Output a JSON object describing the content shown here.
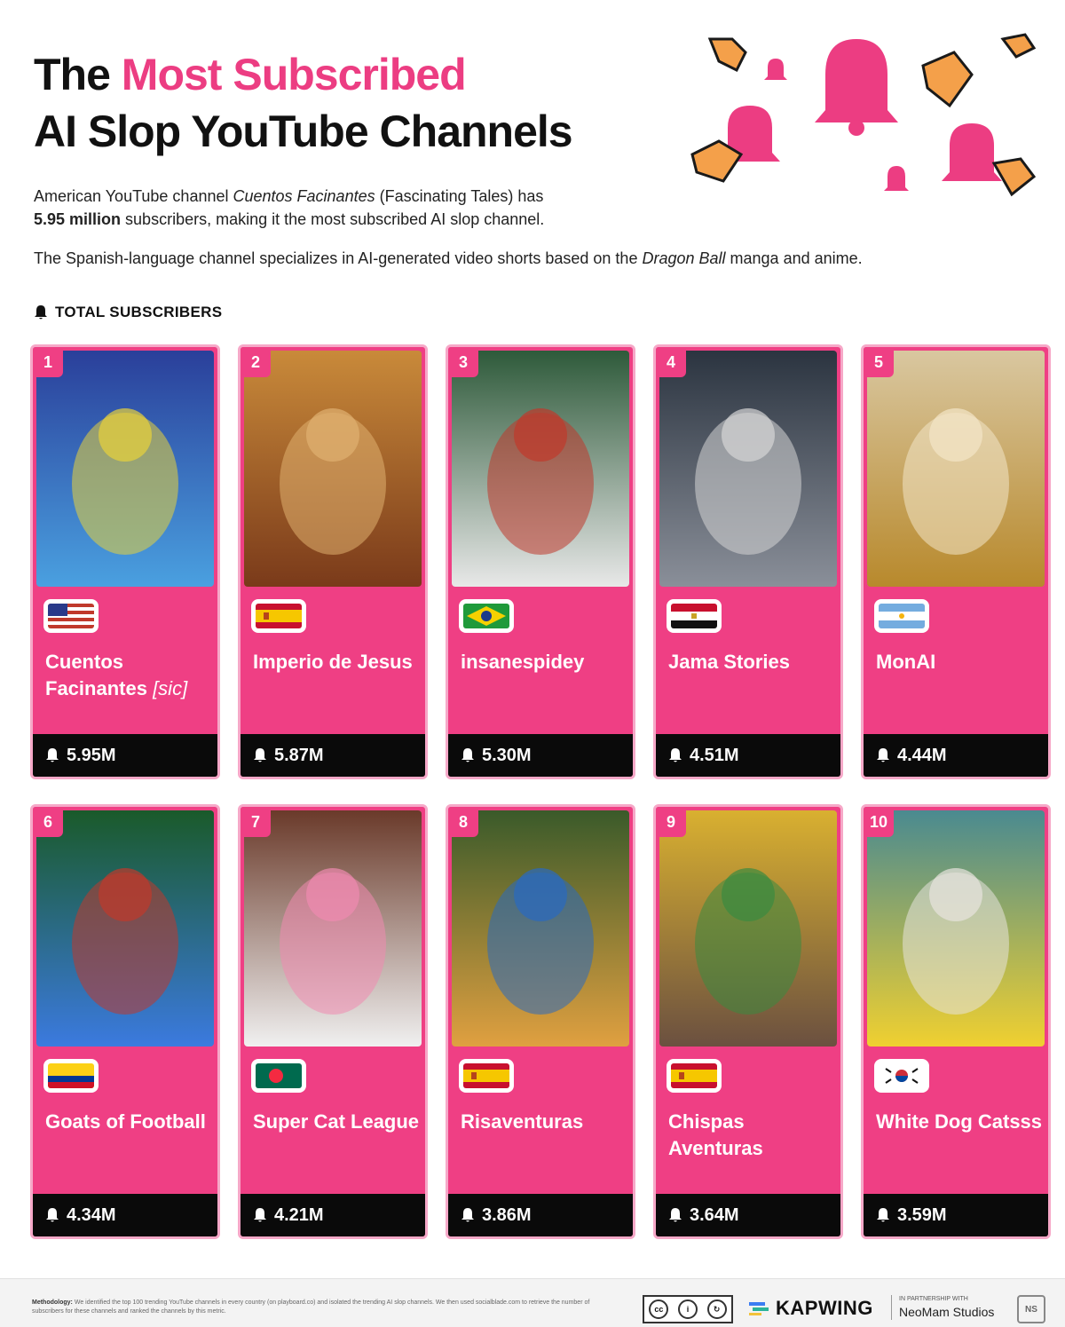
{
  "header": {
    "title_prefix": "The ",
    "title_accent": "Most Subscribed",
    "title_line2": "AI Slop YouTube Channels"
  },
  "intro": {
    "p1_a": "American YouTube channel ",
    "p1_channel": "Cuentos Facinantes",
    "p1_b": " (Fascinating Tales) has ",
    "p1_bold": "5.95 million",
    "p1_c": " subscribers, making it the most subscribed AI slop channel.",
    "p2_a": "The Spanish-language channel specializes in AI-generated video shorts based on the ",
    "p2_italic": "Dragon Ball",
    "p2_b": " manga and anime."
  },
  "legend": {
    "label": "TOTAL SUBSCRIBERS",
    "icon": "bell-icon"
  },
  "colors": {
    "accent": "#ec3d82",
    "card": "#ef3f84",
    "card_border": "#f6a8c8",
    "stat_bar": "#0a0a0a"
  },
  "chart_data": {
    "type": "table",
    "title": "The Most Subscribed AI Slop YouTube Channels",
    "metric": "TOTAL SUBSCRIBERS",
    "rows": [
      {
        "rank": "1",
        "name": "Cuentos Facinantes",
        "sic": "[sic]",
        "country": "US",
        "subscribers": "5.95M",
        "value": 5.95
      },
      {
        "rank": "2",
        "name": "Imperio de Jesus",
        "country": "ES",
        "subscribers": "5.87M",
        "value": 5.87
      },
      {
        "rank": "3",
        "name": "insanespidey",
        "country": "BR",
        "subscribers": "5.30M",
        "value": 5.3
      },
      {
        "rank": "4",
        "name": "Jama Stories",
        "country": "EG",
        "subscribers": "4.51M",
        "value": 4.51
      },
      {
        "rank": "5",
        "name": "MonAI",
        "country": "AR",
        "subscribers": "4.44M",
        "value": 4.44
      },
      {
        "rank": "6",
        "name": "Goats of Football",
        "country": "CO",
        "subscribers": "4.34M",
        "value": 4.34
      },
      {
        "rank": "7",
        "name": "Super Cat League",
        "country": "BD",
        "subscribers": "4.21M",
        "value": 4.21
      },
      {
        "rank": "8",
        "name": "Risaventuras",
        "country": "ES",
        "subscribers": "3.86M",
        "value": 3.86
      },
      {
        "rank": "9",
        "name": "Chispas Aventuras",
        "country": "ES",
        "subscribers": "3.64M",
        "value": 3.64
      },
      {
        "rank": "10",
        "name": "White Dog Catsss",
        "country": "KR",
        "subscribers": "3.59M",
        "value": 3.59
      }
    ]
  },
  "footer": {
    "method_label": "Methodology:",
    "method_text": "We identified the top 100 trending YouTube channels in every country (on playboard.co) and isolated the trending AI slop channels. We then used socialblade.com to retrieve the number of subscribers for these channels and ranked the channels by this metric.",
    "license": "BY SA",
    "brand": "KAPWING",
    "partner_label": "IN PARTNERSHIP WITH",
    "partner_name": "NeoMam Studios"
  }
}
